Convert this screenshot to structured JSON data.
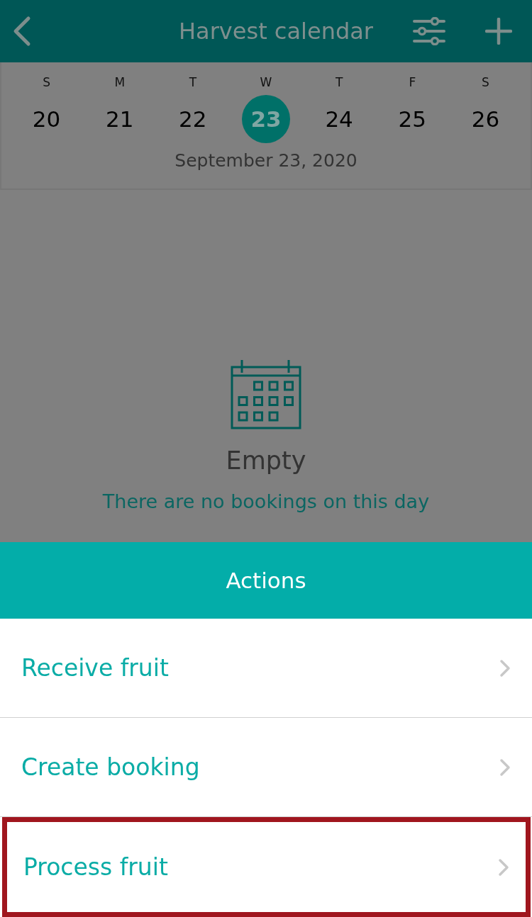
{
  "header": {
    "title": "Harvest calendar"
  },
  "week": {
    "days": [
      {
        "weekday": "S",
        "date": "20",
        "selected": false
      },
      {
        "weekday": "M",
        "date": "21",
        "selected": false
      },
      {
        "weekday": "T",
        "date": "22",
        "selected": false
      },
      {
        "weekday": "W",
        "date": "23",
        "selected": true
      },
      {
        "weekday": "T",
        "date": "24",
        "selected": false
      },
      {
        "weekday": "F",
        "date": "25",
        "selected": false
      },
      {
        "weekday": "S",
        "date": "26",
        "selected": false
      }
    ],
    "selected_date": "September 23, 2020"
  },
  "empty_state": {
    "title": "Empty",
    "message": "There are no bookings on this day"
  },
  "action_sheet": {
    "title": "Actions",
    "items": [
      {
        "label": "Receive fruit",
        "highlighted": false
      },
      {
        "label": "Create booking",
        "highlighted": false
      },
      {
        "label": "Process fruit",
        "highlighted": true
      }
    ]
  }
}
